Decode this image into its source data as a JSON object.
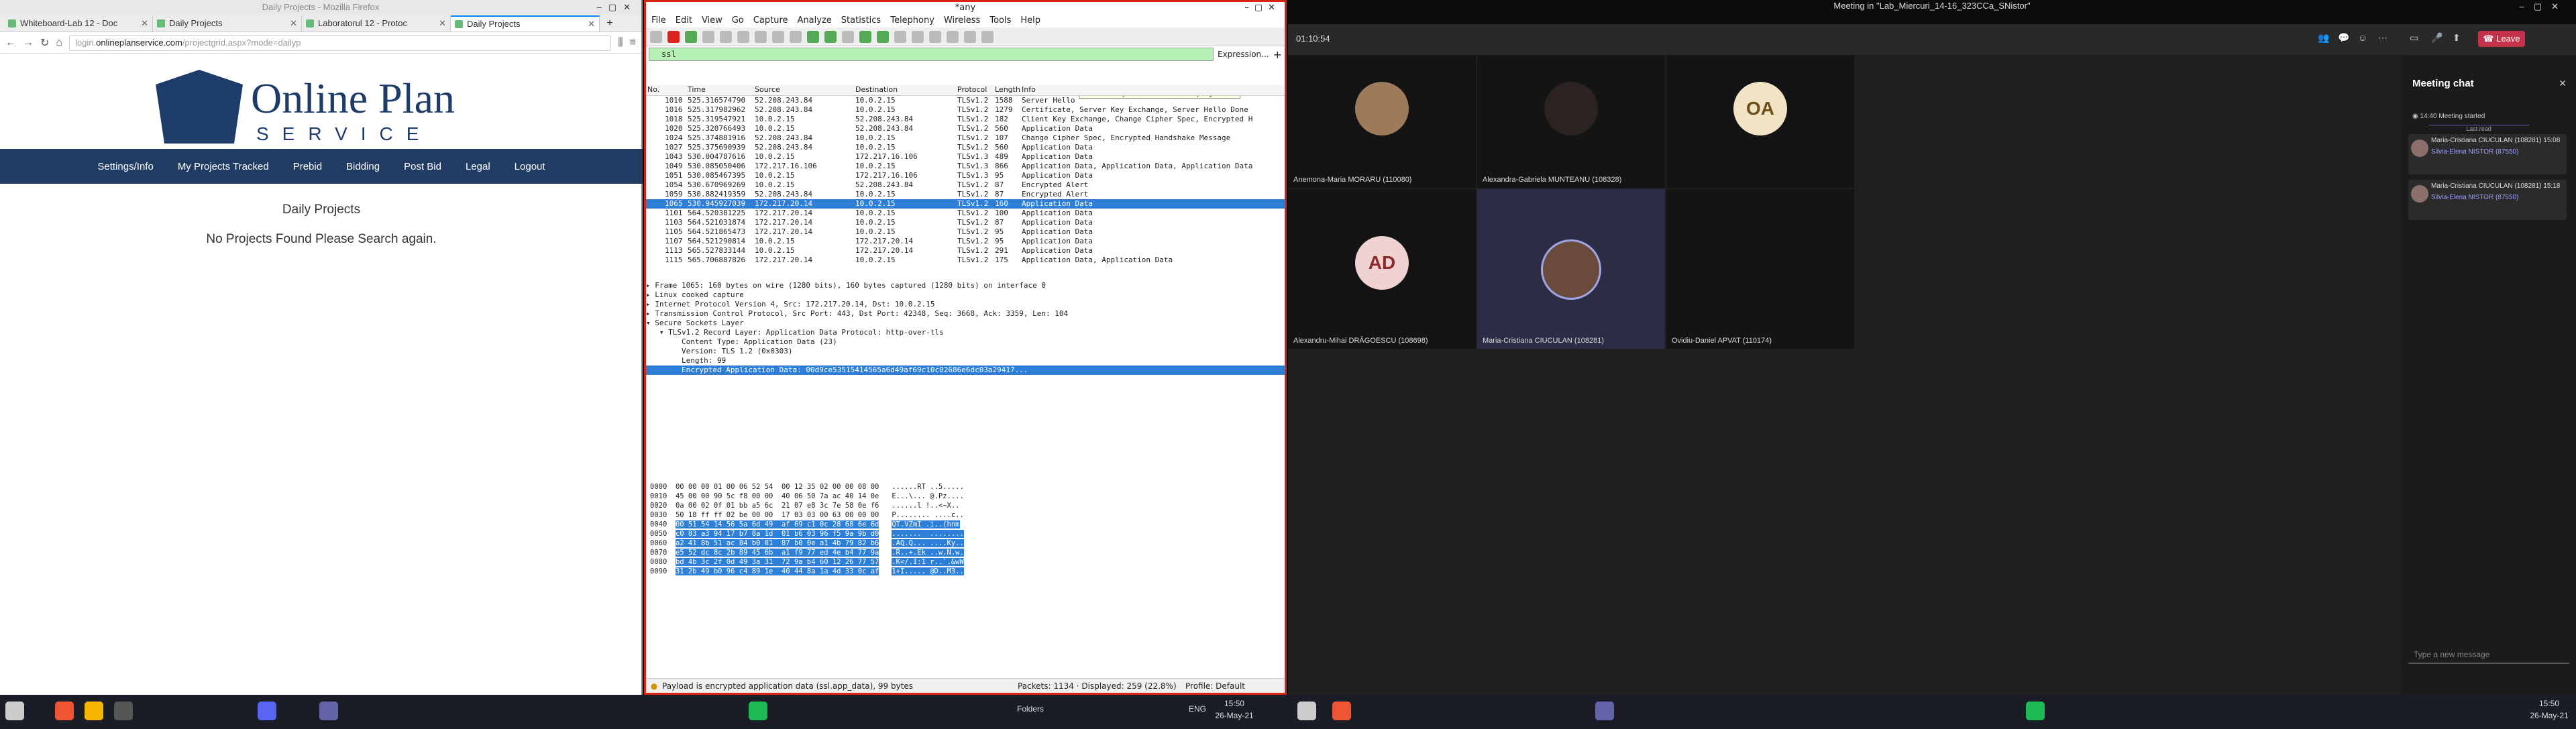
{
  "firefox": {
    "window_title": "Daily Projects - Mozilla Firefox",
    "tabs": [
      {
        "label": "Whiteboard-Lab 12 - Doc"
      },
      {
        "label": "Daily Projects"
      },
      {
        "label": "Laboratorul 12 - Protoc"
      },
      {
        "label": "Daily Projects",
        "active": true
      }
    ],
    "url_prefix": "login.",
    "url_host": "onlineplanservice.com",
    "url_path": "/projectgrid.aspx?mode=dailyp",
    "logo_text": "Online Plan",
    "logo_sub": "SERVICE",
    "nav": [
      "Settings/Info",
      "My Projects Tracked",
      "Prebid",
      "Bidding",
      "Post Bid",
      "Legal",
      "Logout"
    ],
    "heading": "Daily Projects",
    "message": "No Projects Found Please Search again."
  },
  "wireshark": {
    "title": "*any",
    "menu": [
      "File",
      "Edit",
      "View",
      "Go",
      "Capture",
      "Analyze",
      "Statistics",
      "Telephony",
      "Wireless",
      "Tools",
      "Help"
    ],
    "filter": "ssl",
    "expression_label": "Expression...",
    "tooltip": "Add an expression to the display filter.",
    "columns": [
      "No.",
      "Time",
      "Source",
      "Destination",
      "Protocol",
      "Length",
      "Info"
    ],
    "packets": [
      [
        "1010",
        "525.316574790",
        "52.208.243.84",
        "10.0.2.15",
        "TLSv1.2",
        "1588",
        "Server Hello"
      ],
      [
        "1016",
        "525.317982962",
        "52.208.243.84",
        "10.0.2.15",
        "TLSv1.2",
        "1279",
        "Certificate, Server Key Exchange, Server Hello Done"
      ],
      [
        "1018",
        "525.319547921",
        "10.0.2.15",
        "52.208.243.84",
        "TLSv1.2",
        "182",
        "Client Key Exchange, Change Cipher Spec, Encrypted H"
      ],
      [
        "1020",
        "525.320766493",
        "10.0.2.15",
        "52.208.243.84",
        "TLSv1.2",
        "560",
        "Application Data"
      ],
      [
        "1024",
        "525.374881916",
        "52.208.243.84",
        "10.0.2.15",
        "TLSv1.2",
        "107",
        "Change Cipher Spec, Encrypted Handshake Message"
      ],
      [
        "1027",
        "525.375690939",
        "52.208.243.84",
        "10.0.2.15",
        "TLSv1.2",
        "560",
        "Application Data"
      ],
      [
        "1043",
        "530.004787616",
        "10.0.2.15",
        "172.217.16.106",
        "TLSv1.3",
        "489",
        "Application Data"
      ],
      [
        "1049",
        "530.085050406",
        "172.217.16.106",
        "10.0.2.15",
        "TLSv1.3",
        "866",
        "Application Data, Application Data, Application Data"
      ],
      [
        "1051",
        "530.085467395",
        "10.0.2.15",
        "172.217.16.106",
        "TLSv1.3",
        "95",
        "Application Data"
      ],
      [
        "1054",
        "530.670969269",
        "10.0.2.15",
        "52.208.243.84",
        "TLSv1.2",
        "87",
        "Encrypted Alert"
      ],
      [
        "1059",
        "530.882419359",
        "52.208.243.84",
        "10.0.2.15",
        "TLSv1.2",
        "87",
        "Encrypted Alert"
      ],
      [
        "1065",
        "530.945927039",
        "172.217.20.14",
        "10.0.2.15",
        "TLSv1.2",
        "160",
        "Application Data"
      ],
      [
        "1101",
        "564.520381225",
        "172.217.20.14",
        "10.0.2.15",
        "TLSv1.2",
        "100",
        "Application Data"
      ],
      [
        "1103",
        "564.521031874",
        "172.217.20.14",
        "10.0.2.15",
        "TLSv1.2",
        "87",
        "Application Data"
      ],
      [
        "1105",
        "564.521865473",
        "172.217.20.14",
        "10.0.2.15",
        "TLSv1.2",
        "95",
        "Application Data"
      ],
      [
        "1107",
        "564.521290814",
        "10.0.2.15",
        "172.217.20.14",
        "TLSv1.2",
        "95",
        "Application Data"
      ],
      [
        "1113",
        "565.527833144",
        "10.0.2.15",
        "172.217.20.14",
        "TLSv1.2",
        "291",
        "Application Data"
      ],
      [
        "1115",
        "565.706887826",
        "172.217.20.14",
        "10.0.2.15",
        "TLSv1.2",
        "175",
        "Application Data, Application Data"
      ]
    ],
    "selected_packet": "1065",
    "details": [
      "▸ Frame 1065: 160 bytes on wire (1280 bits), 160 bytes captured (1280 bits) on interface 0",
      "▸ Linux cooked capture",
      "▸ Internet Protocol Version 4, Src: 172.217.20.14, Dst: 10.0.2.15",
      "▸ Transmission Control Protocol, Src Port: 443, Dst Port: 42348, Seq: 3668, Ack: 3359, Len: 104",
      "▾ Secure Sockets Layer",
      "   ▾ TLSv1.2 Record Layer: Application Data Protocol: http-over-tls",
      "        Content Type: Application Data (23)",
      "        Version: TLS 1.2 (0x0303)",
      "        Length: 99",
      "        Encrypted Application Data: 00d9ce53515414565a6d49af69c10c82686e6dc03a29417..."
    ],
    "hex": [
      [
        "0000",
        "00 00 00 01 00 06 52 54  00 12 35 02 00 00 08 00",
        "......RT ..5....."
      ],
      [
        "0010",
        "45 00 00 90 5c f8 00 00  40 06 50 7a ac 40 14 0e",
        "E...\\... @.Pz...."
      ],
      [
        "0020",
        "0a 00 02 0f 01 bb a5 6c  21 07 e8 3c 7e 58 0e f6",
        "......l !..<~X.."
      ],
      [
        "0030",
        "50 18 ff ff 02 be 00 00  17 03 03 00 63 00 00 00",
        "P........ ....c.."
      ],
      [
        "0040",
        "00 51 54 14 56 5a 6d 49  af 69 c1 0c 28 68 6e 6d",
        "QT.VZmI .i..(hnm"
      ],
      [
        "0050",
        "c0 83 a3 94 17 b7 8a 1d  01 b6 03 96 f5 9a 9b d0",
        ".......  ........"
      ],
      [
        "0060",
        "a2 41 8b 51 ac 84 b0 81  87 b0 0e a1 4b 79 82 b6",
        ".AQ.Q... ....Ky.."
      ],
      [
        "0070",
        "e5 52 dc 8c 2b 89 45 6b  a1 f9 77 ed 4e b4 77 9a",
        ".R..+.Ek ..w.N.w."
      ],
      [
        "0080",
        "bd 4b 3c 2f 0d 49 3a 31  72 9a b4 60 12 26 77 57",
        ".K</.I:1 r..`.&wW"
      ],
      [
        "0090",
        "31 2b 49 b0 96 c4 89 1e  40 44 8a 1a 4d 33 0c af",
        "1+I..... @D..M3.."
      ]
    ],
    "status_text": "Payload is encrypted application data (ssl.app_data), 99 bytes",
    "status_packets": "Packets: 1134 · Displayed: 259 (22.8%)",
    "status_profile": "Profile: Default"
  },
  "teams": {
    "title": "Meeting in \"Lab_Miercuri_14-16_323CCa_SNistor\"",
    "timer": "01:10:54",
    "leave_label": "Leave",
    "participants": [
      {
        "name": "Anemona-Maria MORARU (110080)",
        "kind": "photo",
        "color": "#9c7a5a"
      },
      {
        "name": "Alexandra-Gabriela MUNTEANU (108328)",
        "kind": "photo",
        "color": "#2a2320"
      },
      {
        "name": "",
        "kind": "initials",
        "initials": "OA",
        "bg": "#f1e3c4",
        "fg": "#6b4e1c"
      },
      {
        "name": "Alexandru-Mihai DRĂGOESCU (108698)",
        "kind": "initials",
        "initials": "AD",
        "bg": "#f1d2d2",
        "fg": "#8a2a2a"
      },
      {
        "name": "Maria-Cristiana CIUCULAN (108281)",
        "kind": "photo",
        "color": "#6a4a3a"
      },
      {
        "name": "Ovidiu-Daniel APVAT (110174)",
        "kind": "empty"
      }
    ],
    "chat_title": "Meeting chat",
    "chat_started_time": "14:40",
    "chat_started": "Meeting started",
    "last_read": "Last read",
    "messages": [
      {
        "author": "Maria-Cristiana CIUCULAN (108281)",
        "time": "15:08",
        "text": "Silvia-Elena NISTOR (87550)"
      },
      {
        "author": "Maria-Cristiana CIUCULAN (108281)",
        "time": "15:18",
        "text": "Silvia-Elena NISTOR (87550)"
      }
    ],
    "compose_placeholder": "Type a new message"
  },
  "taskbar": {
    "left_time": "15:50",
    "left_date": "26-May-21",
    "folders": "Folders",
    "lang": "ENG",
    "right_time": "15:50",
    "right_date": "26-May-21"
  }
}
